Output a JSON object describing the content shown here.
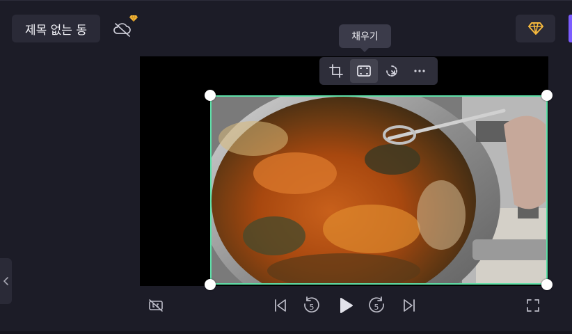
{
  "project": {
    "title": "제목 없는 동"
  },
  "tooltip": {
    "label": "채우기"
  },
  "icons": {
    "cloud": "cloud-off-icon",
    "premium": "diamond-icon",
    "crop": "crop-icon",
    "fill": "fill-frame-icon",
    "rotate": "rotate-icon",
    "more": "more-icon",
    "collapse": "chevron-left-icon",
    "captions": "captions-off-icon",
    "skip_back": "skip-back-icon",
    "rewind5": "rewind-5-icon",
    "play": "play-icon",
    "forward5": "forward-5-icon",
    "skip_forward": "skip-forward-icon",
    "fullscreen": "fullscreen-icon"
  },
  "controls": {
    "rewind_seconds": "5",
    "forward_seconds": "5"
  },
  "colors": {
    "background": "#1c1c27",
    "selection_border": "#5ee0a8",
    "premium_gem": "#f5b83d",
    "accent": "#7c5cff"
  }
}
